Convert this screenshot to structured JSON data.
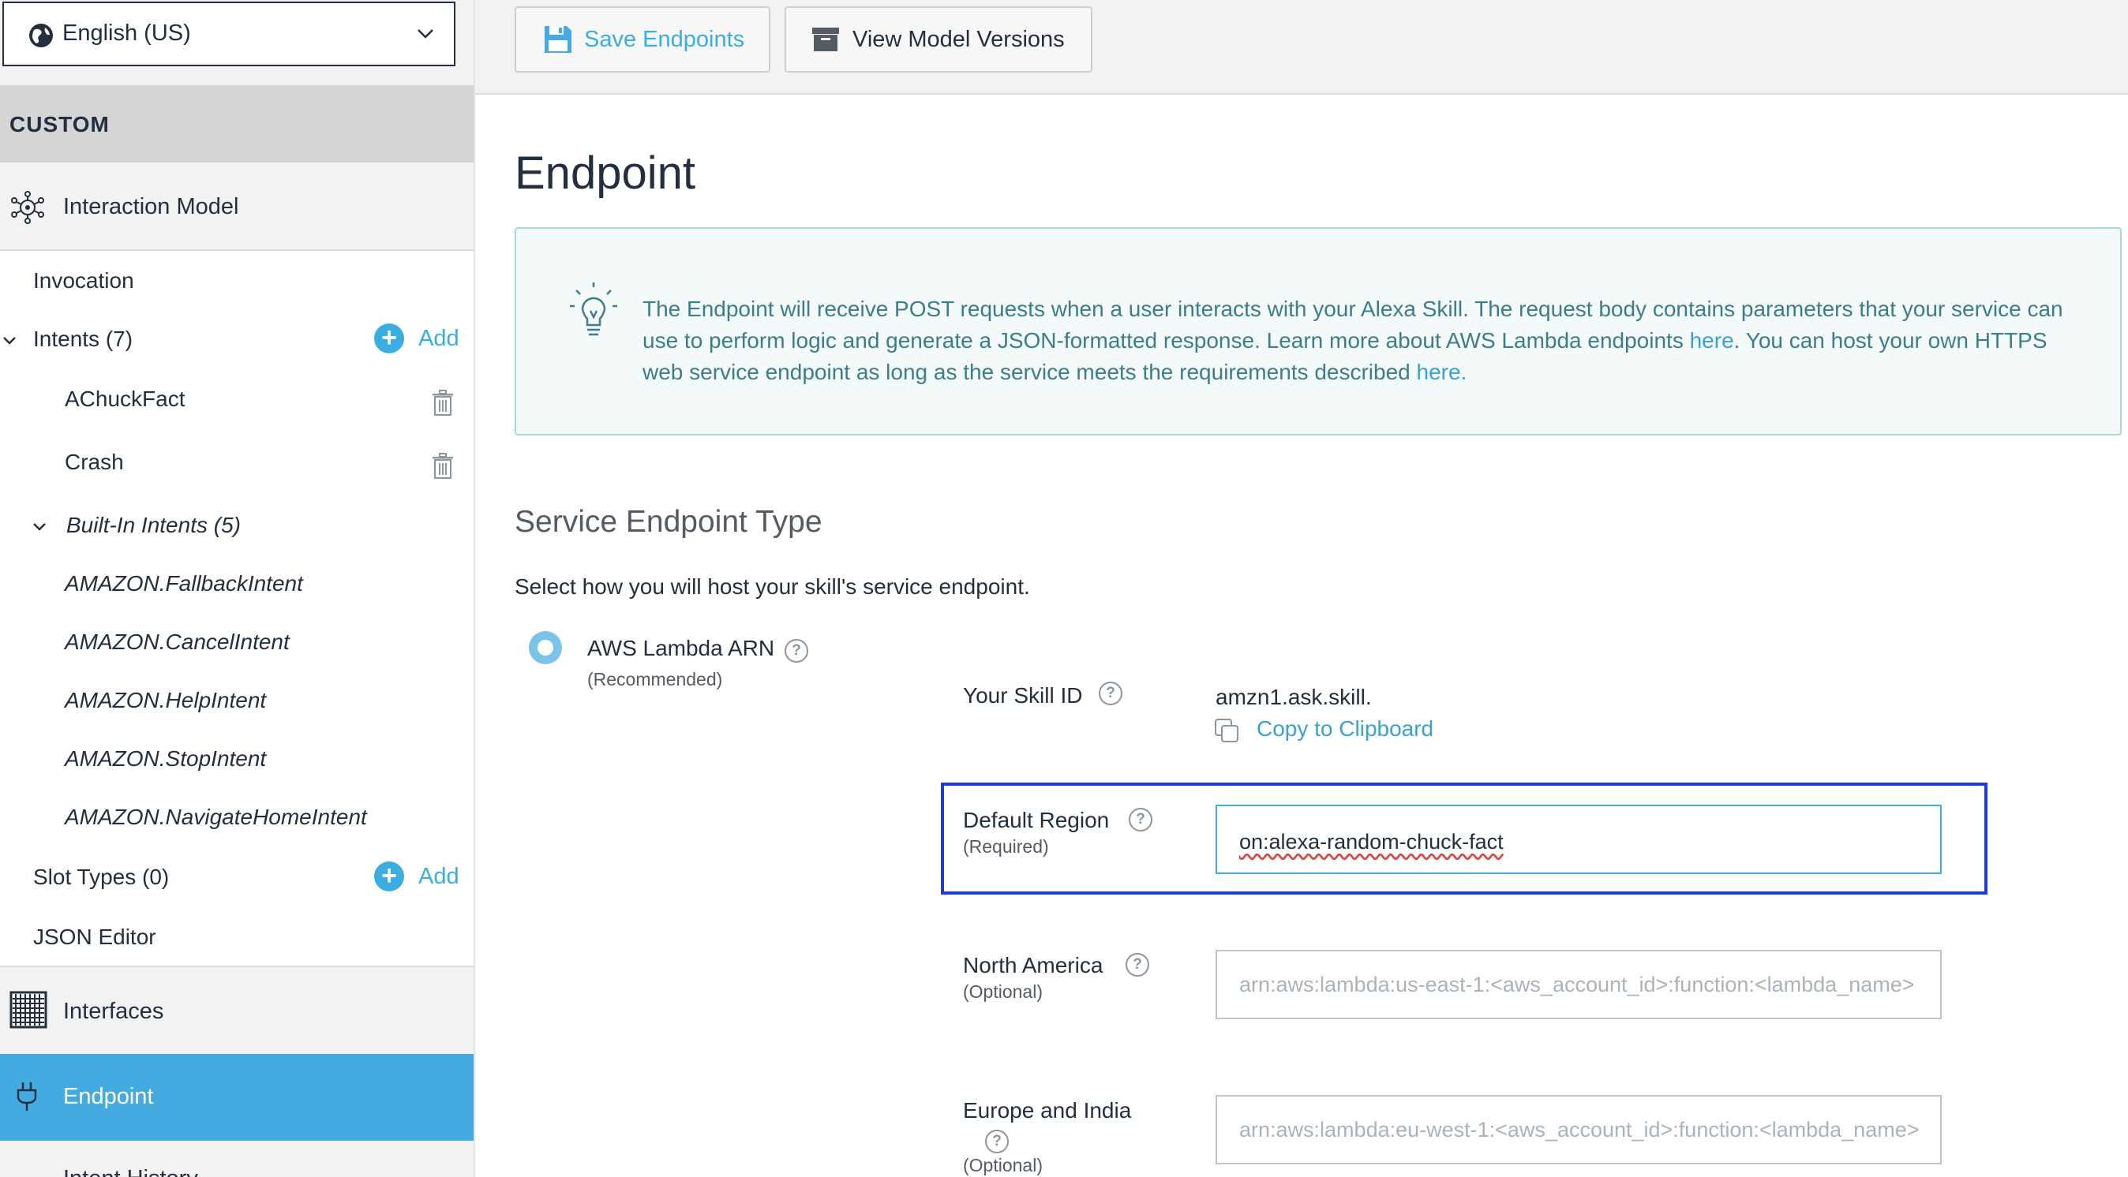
{
  "sidebar": {
    "language": "English (US)",
    "section_header": "CUSTOM",
    "interaction_model": "Interaction Model",
    "invocation": "Invocation",
    "intents": "Intents (7)",
    "add_label": "Add",
    "custom_intents": [
      "AChuckFact",
      "Crash"
    ],
    "builtin_header": "Built-In Intents (5)",
    "builtin_intents": [
      "AMAZON.FallbackIntent",
      "AMAZON.CancelIntent",
      "AMAZON.HelpIntent",
      "AMAZON.StopIntent",
      "AMAZON.NavigateHomeIntent"
    ],
    "slot_types": "Slot Types (0)",
    "json_editor": "JSON Editor",
    "interfaces": "Interfaces",
    "endpoint": "Endpoint",
    "next_item": "Intent History"
  },
  "toolbar": {
    "save_label": "Save Endpoints",
    "versions_label": "View Model Versions"
  },
  "main": {
    "title": "Endpoint",
    "info_part1": "The Endpoint will receive POST requests when a user interacts with your Alexa Skill. The request body contains parameters that your service can use to perform logic and generate a JSON-formatted response. Learn more about AWS Lambda endpoints ",
    "info_link1": "here",
    "info_part2": ". You can host your own HTTPS web service endpoint as long as the service meets the requirements described ",
    "info_link2": "here.",
    "section_title": "Service Endpoint Type",
    "section_desc": "Select how you will host your skill's service endpoint.",
    "option_label": "AWS Lambda ARN",
    "option_sub": "(Recommended)",
    "skill_id_label": "Your Skill ID",
    "skill_id_value": "amzn1.ask.skill.",
    "copy_label": "Copy to Clipboard",
    "default_region_label": "Default Region",
    "required": "(Required)",
    "default_region_value": "on:alexa-random-chuck-fact",
    "north_america_label": "North America",
    "optional": "(Optional)",
    "north_america_placeholder": "arn:aws:lambda:us-east-1:<aws_account_id>:function:<lambda_name>",
    "europe_label": "Europe and India",
    "europe_placeholder": "arn:aws:lambda:eu-west-1:<aws_account_id>:function:<lambda_name>"
  },
  "colors": {
    "accent": "#44abe0",
    "link": "#3aa1d6",
    "highlight_border": "#1f3ecf",
    "info_text": "#3c7d8a"
  }
}
